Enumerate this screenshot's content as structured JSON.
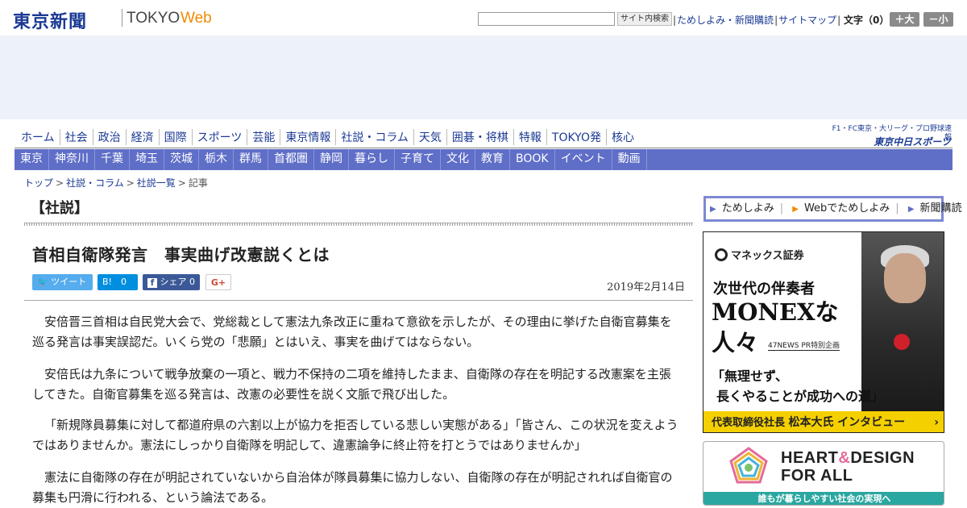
{
  "header": {
    "logo_main": "東京新聞",
    "logo_tokyo": "TOKYO",
    "logo_web": "Web",
    "search_placeholder": "",
    "search_button": "サイト内検索",
    "link_trial": "ためしよみ・新聞購読",
    "link_sitemap": "サイトマップ",
    "font_size_label": "文字（0）",
    "font_larger": "＋大",
    "font_smaller": "－小"
  },
  "nav_main": [
    "ホーム",
    "社会",
    "政治",
    "経済",
    "国際",
    "スポーツ",
    "芸能",
    "東京情報",
    "社説・コラム",
    "天気",
    "囲碁・将棋",
    "特報",
    "TOKYO発",
    "核心"
  ],
  "chunichi": {
    "tagline": "F1・FC東京・大リーグ・プロ野球速報",
    "logo": "東京中日スポーツ"
  },
  "nav_sub": [
    "東京",
    "神奈川",
    "千葉",
    "埼玉",
    "茨城",
    "栃木",
    "群馬",
    "首都圏",
    "静岡",
    "暮らし",
    "子育て",
    "文化",
    "教育",
    "BOOK",
    "イベント",
    "動画"
  ],
  "breadcrumb": {
    "items": [
      "トップ",
      "社説・コラム",
      "社説一覧"
    ],
    "current": "記事",
    "separator": ">"
  },
  "article": {
    "section": "【社説】",
    "title": "首相自衛隊発言　事実曲げ改憲説くとは",
    "date": "2019年2月14日",
    "share": {
      "tweet": "ツイート",
      "hatena": "B!　0",
      "facebook": "シェア 0",
      "gplus": "G+"
    },
    "paragraphs": [
      "安倍晋三首相は自民党大会で、党総裁として憲法九条改正に重ねて意欲を示したが、その理由に挙げた自衛官募集を巡る発言は事実誤認だ。いくら党の「悲願」とはいえ、事実を曲げてはならない。",
      "安倍氏は九条について戦争放棄の一項と、戦力不保持の二項を維持したまま、自衛隊の存在を明記する改憲案を主張してきた。自衛官募集を巡る発言は、改憲の必要性を説く文脈で飛び出した。",
      "「新規隊員募集に対して都道府県の六割以上が協力を拒否している悲しい実態がある」「皆さん、この状況を変えようではありませんか。憲法にしっかり自衛隊を明記して、違憲論争に終止符を打とうではありませんか」",
      "憲法に自衛隊の存在が明記されていないから自治体が隊員募集に協力しない、自衛隊の存在が明記されれば自衛官の募集も円滑に行われる、という論法である。"
    ]
  },
  "sidebar": {
    "links": [
      "ためしよみ",
      "Webでためしよみ",
      "新聞購読"
    ],
    "ad_monex": {
      "brand": "マネックス証券",
      "subtitle": "次世代の伴奏者",
      "headline_1": "MONEXな",
      "headline_2": "人々",
      "news_tag": "47NEWS PR特別企画",
      "quote_1": "「無理せず、",
      "quote_2": "長くやることが成功への道」",
      "bar_role": "代表取締役社長",
      "bar_name": "松本大氏",
      "bar_suffix": "インタビュー",
      "bar_arrow": "›"
    },
    "ad_heart": {
      "title_1": "HEART",
      "amp": "&",
      "title_2": "DESIGN",
      "title_3": "FOR ALL",
      "bar": "誰もが暮らしやすい社会の実現へ"
    }
  },
  "colors": {
    "brand_blue": "#1b3a94",
    "nav_sub_bg": "#5f6ec7",
    "web_orange": "#f08a00",
    "ad_band": "#edf1f9"
  }
}
